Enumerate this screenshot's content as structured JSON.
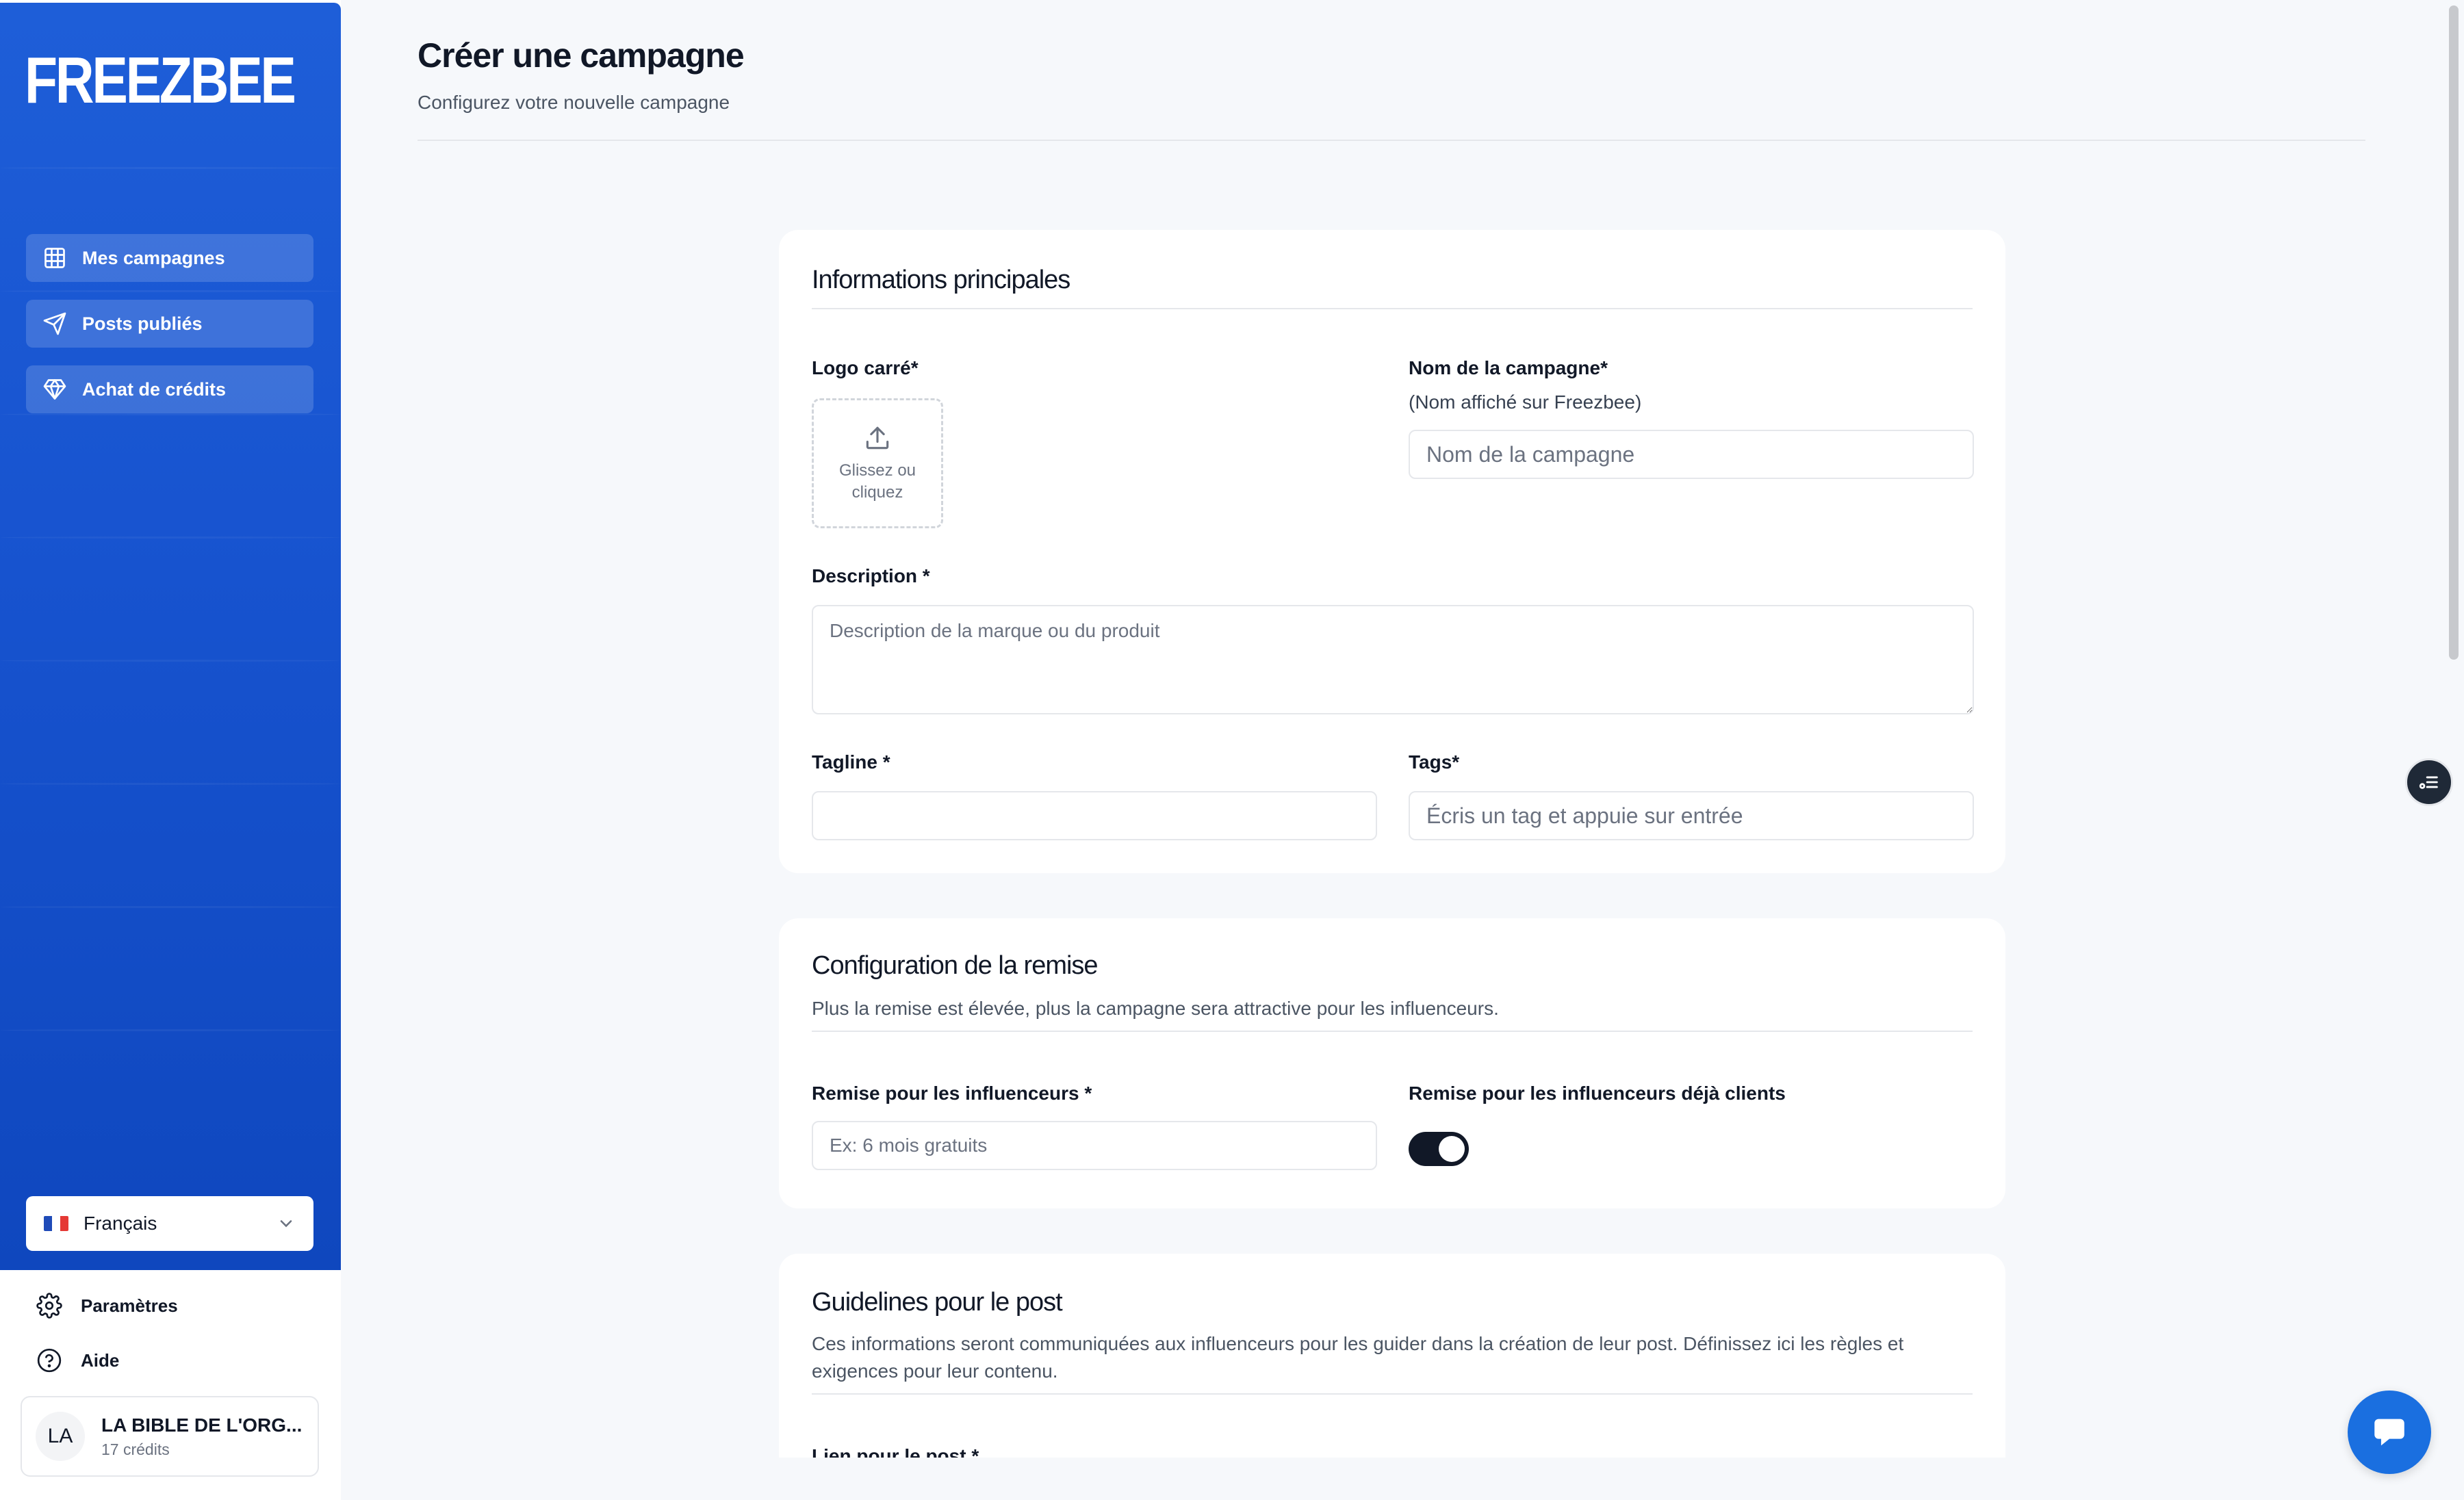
{
  "sidebar": {
    "logo": "FREEZBEE",
    "nav": [
      {
        "label": "Mes campagnes",
        "icon": "grid-icon"
      },
      {
        "label": "Posts publiés",
        "icon": "send-icon"
      },
      {
        "label": "Achat de crédits",
        "icon": "diamond-icon"
      }
    ],
    "language": {
      "label": "Français",
      "icon": "french-flag-icon"
    },
    "links": [
      {
        "label": "Paramètres",
        "icon": "gear-icon"
      },
      {
        "label": "Aide",
        "icon": "help-icon"
      }
    ],
    "account": {
      "initials": "LA",
      "name": "LA BIBLE DE L'ORG...",
      "credits": "17 crédits"
    }
  },
  "header": {
    "title": "Créer une campagne",
    "subtitle": "Configurez votre nouvelle campagne"
  },
  "main_info": {
    "title": "Informations principales",
    "logo_label": "Logo carré*",
    "upload_text": "Glissez ou cliquez",
    "name_label": "Nom de la campagne*",
    "name_hint": "(Nom affiché sur Freezbee)",
    "name_placeholder": "Nom de la campagne",
    "description_label": "Description *",
    "description_placeholder": "Description de la marque ou du produit",
    "tagline_label": "Tagline *",
    "tagline_value": "",
    "tags_label": "Tags*",
    "tags_placeholder": "Écris un tag et appuie sur entrée"
  },
  "discount": {
    "title": "Configuration de la remise",
    "description": "Plus la remise est élevée, plus la campagne sera attractive pour les influenceurs.",
    "influencer_label": "Remise pour les influenceurs *",
    "influencer_placeholder": "Ex: 6 mois gratuits",
    "existing_clients_label": "Remise pour les influenceurs déjà clients",
    "existing_clients_enabled": true
  },
  "guidelines": {
    "title": "Guidelines pour le post",
    "description": "Ces informations seront communiquées aux influenceurs pour les guider dans la création de leur post. Définissez ici les règles et exigences pour leur contenu.",
    "link_label": "Lien pour le post *"
  },
  "colors": {
    "sidebar_blue": "#1753cf",
    "chat_blue": "#1a6fe0",
    "toggle_on": "#111827"
  }
}
